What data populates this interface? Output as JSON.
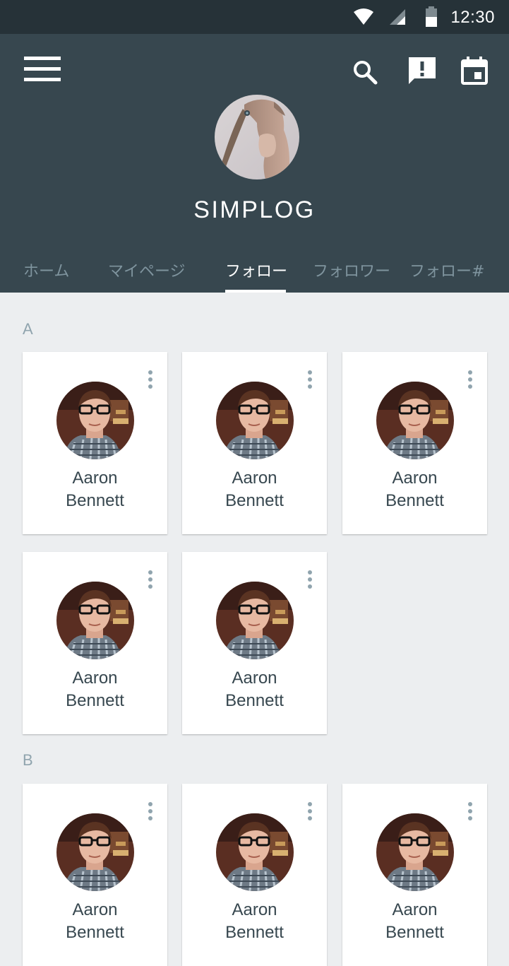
{
  "status_bar": {
    "time": "12:30"
  },
  "app": {
    "title": "SIMPLOG"
  },
  "tabs": [
    {
      "label": "ホーム",
      "active": false
    },
    {
      "label": "マイページ",
      "active": false
    },
    {
      "label": "フォロー",
      "active": true
    },
    {
      "label": "フォロワー",
      "active": false
    },
    {
      "label": "フォロー#",
      "active": false
    }
  ],
  "sections": [
    {
      "letter": "A",
      "cards": [
        {
          "first": "Aaron",
          "last": "Bennett"
        },
        {
          "first": "Aaron",
          "last": "Bennett"
        },
        {
          "first": "Aaron",
          "last": "Bennett"
        },
        {
          "first": "Aaron",
          "last": "Bennett"
        },
        {
          "first": "Aaron",
          "last": "Bennett"
        }
      ]
    },
    {
      "letter": "B",
      "cards": [
        {
          "first": "Aaron",
          "last": "Bennett"
        },
        {
          "first": "Aaron",
          "last": "Bennett"
        },
        {
          "first": "Aaron",
          "last": "Bennett"
        }
      ]
    }
  ],
  "icons": {
    "menu": "menu-icon",
    "search": "search-icon",
    "feedback": "feedback-icon",
    "calendar": "calendar-icon"
  },
  "colors": {
    "status_bar": "#263238",
    "app_bar": "#37474F",
    "background": "#ECEEF0",
    "tab_inactive": "#7F949E",
    "text_dark": "#37474F"
  }
}
